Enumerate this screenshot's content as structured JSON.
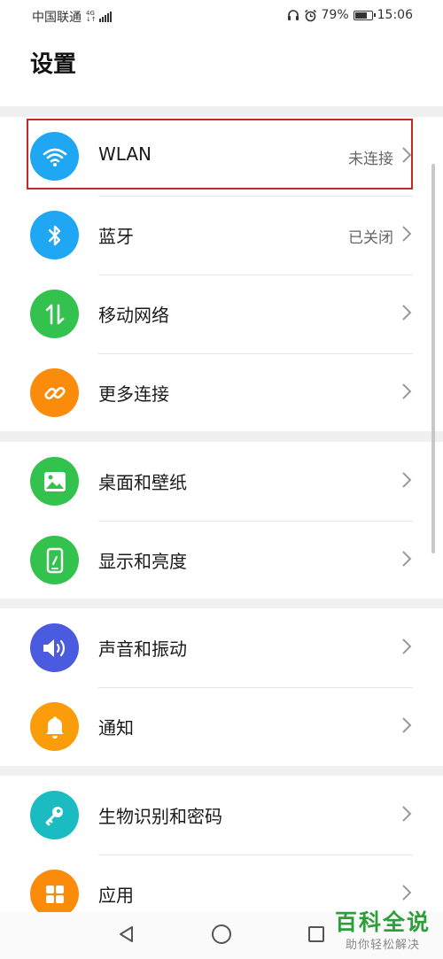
{
  "status_bar": {
    "carrier": "中国联通",
    "network_top": "4G",
    "network_bottom": "↓↑",
    "battery": "79%",
    "time": "15:06",
    "battery_level": 0.79
  },
  "header": {
    "title": "设置"
  },
  "rows": [
    {
      "label": "WLAN",
      "value": "未连接",
      "icon": "wifi-icon",
      "color": "#1fa7f3"
    },
    {
      "label": "蓝牙",
      "value": "已关闭",
      "icon": "bluetooth-icon",
      "color": "#1fa7f3"
    },
    {
      "label": "移动网络",
      "value": "",
      "icon": "mobile-data-icon",
      "color": "#34c24f"
    },
    {
      "label": "更多连接",
      "value": "",
      "icon": "link-icon",
      "color": "#fb8c0b"
    },
    {
      "label": "桌面和壁纸",
      "value": "",
      "icon": "wallpaper-icon",
      "color": "#34c24f"
    },
    {
      "label": "显示和亮度",
      "value": "",
      "icon": "display-icon",
      "color": "#34c24f"
    },
    {
      "label": "声音和振动",
      "value": "",
      "icon": "sound-icon",
      "color": "#4a5be0"
    },
    {
      "label": "通知",
      "value": "",
      "icon": "notification-icon",
      "color": "#fb9c0b"
    },
    {
      "label": "生物识别和密码",
      "value": "",
      "icon": "key-icon",
      "color": "#1bbcc1"
    },
    {
      "label": "应用",
      "value": "",
      "icon": "apps-icon",
      "color": "#fb8c0b"
    }
  ],
  "watermark": {
    "title": "百科全说",
    "subtitle": "助你轻松解决"
  }
}
